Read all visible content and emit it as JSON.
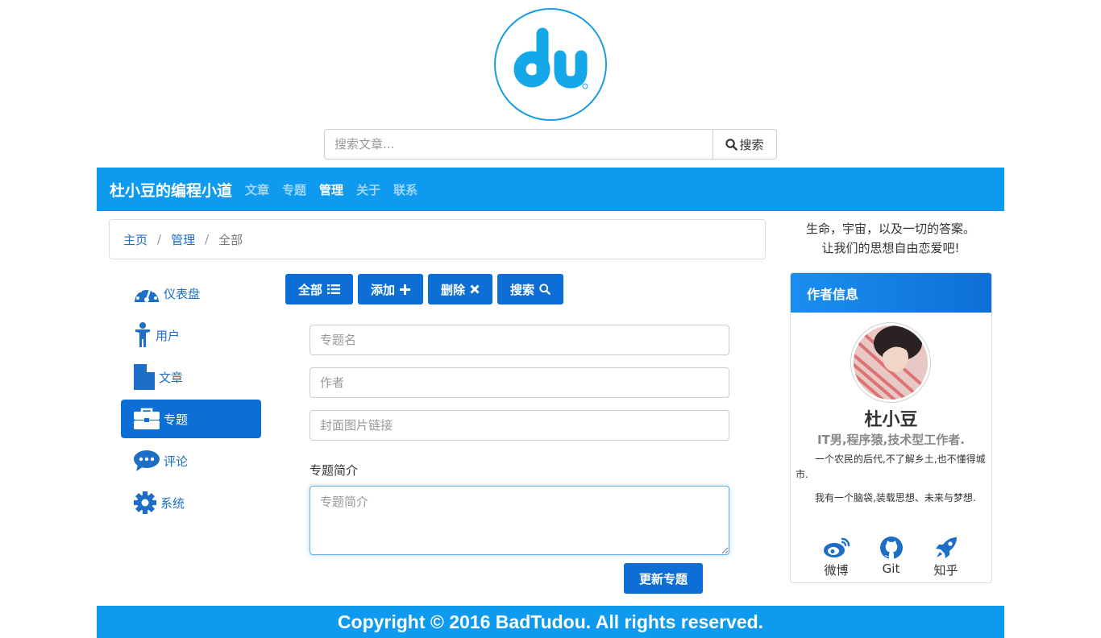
{
  "search": {
    "placeholder": "搜索文章...",
    "button_label": "搜索",
    "icon": "search-icon"
  },
  "navbar": {
    "brand": "杜小豆的编程小道",
    "items": [
      {
        "label": "文章",
        "active": false
      },
      {
        "label": "专题",
        "active": false
      },
      {
        "label": "管理",
        "active": true
      },
      {
        "label": "关于",
        "active": false
      },
      {
        "label": "联系",
        "active": false
      }
    ]
  },
  "breadcrumb": {
    "items": [
      "主页",
      "管理"
    ],
    "separator": "/",
    "current": "全部"
  },
  "sidebar": {
    "items": [
      {
        "label": "仪表盘",
        "icon": "dashboard-icon",
        "active": false
      },
      {
        "label": "用户",
        "icon": "user-icon",
        "active": false
      },
      {
        "label": "文章",
        "icon": "file-icon",
        "active": false
      },
      {
        "label": "专题",
        "icon": "briefcase-icon",
        "active": true
      },
      {
        "label": "评论",
        "icon": "comment-icon",
        "active": false
      },
      {
        "label": "系统",
        "icon": "gear-icon",
        "active": false
      }
    ]
  },
  "actions": {
    "all_label": "全部",
    "add_label": "添加",
    "delete_label": "删除",
    "search_label": "搜索"
  },
  "form": {
    "name_placeholder": "专题名",
    "author_placeholder": "作者",
    "cover_placeholder": "封面图片链接",
    "intro_label": "专题简介",
    "intro_placeholder": "专题简介",
    "submit_label": "更新专题"
  },
  "motto": {
    "line1": "生命，宇宙，以及一切的答案。",
    "line2": "让我们的思想自由恋爱吧!"
  },
  "author": {
    "panel_title": "作者信息",
    "name": "杜小豆",
    "tagline": "IT男,程序猿,技术型工作者.",
    "desc1": "一个农民的后代,不了解乡土,也不懂得城市.",
    "desc2": "我有一个脑袋,装载思想、未来与梦想.",
    "socials": [
      {
        "label": "微博",
        "icon": "weibo-icon"
      },
      {
        "label": "Git",
        "icon": "github-icon"
      },
      {
        "label": "知乎",
        "icon": "rocket-icon"
      }
    ]
  },
  "footer": {
    "text": "Copyright © 2016 BadTudou. All rights reserved."
  },
  "colors": {
    "primary": "#0e9aee",
    "button": "#0d6fd6",
    "link": "#1c6ec6"
  }
}
